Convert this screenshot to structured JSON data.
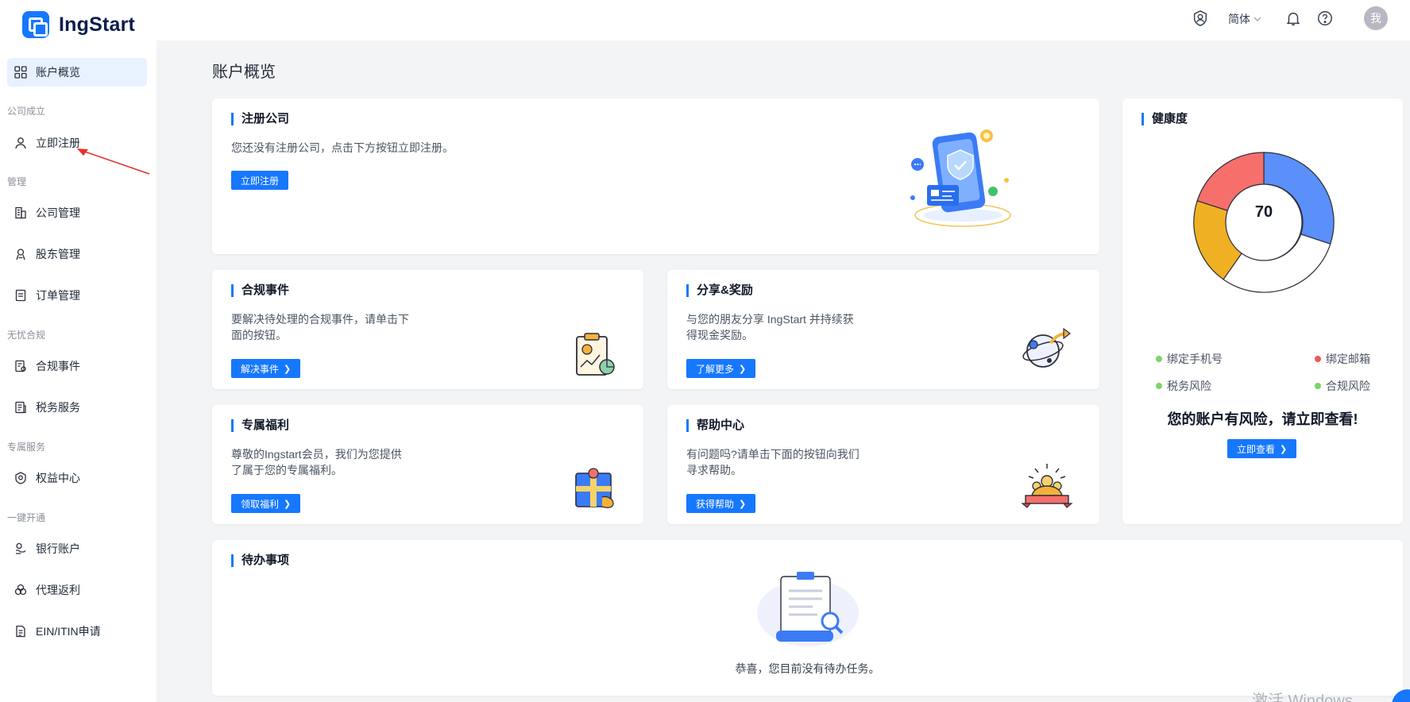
{
  "header": {
    "brand": "IngStart",
    "language": "简体",
    "avatar_text": "我"
  },
  "sidebar": {
    "overview": "账户概览",
    "sections": {
      "company_setup": "公司成立",
      "management": "管理",
      "compliance": "无忧合规",
      "exclusive": "专属服务",
      "one_click": "一键开通"
    },
    "items": {
      "register": "立即注册",
      "company_mgmt": "公司管理",
      "shareholder_mgmt": "股东管理",
      "order_mgmt": "订单管理",
      "compliance_events": "合规事件",
      "tax_service": "税务服务",
      "benefits_center": "权益中心",
      "bank_account": "银行账户",
      "agent_rebate": "代理返利",
      "ein_itin": "EIN/ITIN申请"
    }
  },
  "main": {
    "page_title": "账户概览",
    "register_card": {
      "title": "注册公司",
      "desc": "您还没有注册公司，点击下方按钮立即注册。",
      "button": "立即注册"
    },
    "compliance_card": {
      "title": "合规事件",
      "desc_line1": "要解决待处理的合规事件，请单击下",
      "desc_line2": "面的按钮。",
      "button": "解决事件"
    },
    "share_card": {
      "title": "分享&奖励",
      "desc_line1": "与您的朋友分享 IngStart 并持续获",
      "desc_line2": "得现金奖励。",
      "button": "了解更多"
    },
    "benefit_card": {
      "title": "专属福利",
      "desc_line1": "尊敬的Ingstart会员，我们为您提供",
      "desc_line2": "了属于您的专属福利。",
      "button": "领取福利"
    },
    "help_card": {
      "title": "帮助中心",
      "desc_line1": "有问题吗?请单击下面的按钮向我们",
      "desc_line2": "寻求帮助。",
      "button": "获得帮助"
    },
    "health_card": {
      "title": "健康度",
      "score": "70",
      "legend": {
        "phone": "绑定手机号",
        "email": "绑定邮箱",
        "tax": "税务风险",
        "compliance": "合规风险"
      },
      "risk_message": "您的账户有风险，请立即查看!",
      "button": "立即查看"
    },
    "todo_card": {
      "title": "待办事项",
      "empty_text": "恭喜，您目前没有待办任务。"
    }
  },
  "watermark": "激活 Windows",
  "colors": {
    "primary": "#1677ff",
    "donut_blue": "#5b8ff9",
    "donut_orange": "#f0b023",
    "donut_red": "#f66f6a",
    "ok_green": "#7ed36a",
    "bad_red": "#f0565a"
  }
}
